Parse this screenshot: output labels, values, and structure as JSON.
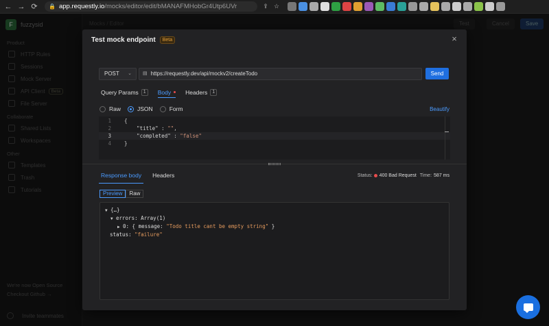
{
  "browser": {
    "url_host": "app.requestly.io",
    "url_path": "/mocks/editor/edit/bMANAFMHobGr4Utp6UVr",
    "extension_colors": [
      "#777",
      "#4a90e2",
      "#aaa",
      "#e0e0e0",
      "#2ea043",
      "#dd4444",
      "#e0a030",
      "#9b59b6",
      "#5dbb63",
      "#3a7bd5",
      "#2aa198",
      "#999",
      "#aaa",
      "#e6c35c",
      "#aaa",
      "#ccc",
      "#aaa",
      "#8bc34a",
      "#ccc",
      "#999"
    ]
  },
  "app": {
    "workspace_initial": "F",
    "workspace_name": "fuzzysid",
    "sections": [
      {
        "title": "Product",
        "items": [
          "HTTP Rules",
          "Sessions",
          "Mock Server",
          "API Client",
          "File Server"
        ]
      },
      {
        "title": "Collaborate",
        "items": [
          "Shared Lists",
          "Workspaces"
        ]
      },
      {
        "title": "Other",
        "items": [
          "Templates",
          "Trash",
          "Tutorials"
        ]
      }
    ],
    "api_client_pill": "Beta",
    "footer_line1": "We're now Open Source",
    "footer_line2": "Checkout Github →",
    "invite": "Invite teammates",
    "crumb": "Mocks / Editor",
    "test_label": "Test",
    "cancel_label": "Cancel",
    "save_label": "Save"
  },
  "modal": {
    "title": "Test mock endpoint",
    "badge": "Beta",
    "close": "×",
    "method": "POST",
    "url": "https://requestly.dev/api/mockv2/createTodo",
    "send": "Send",
    "tabs": [
      {
        "label": "Query Params",
        "count": "1"
      },
      {
        "label": "Body"
      },
      {
        "label": "Headers",
        "count": "1"
      }
    ],
    "body_types": [
      "Raw",
      "JSON",
      "Form"
    ],
    "selected_body_type": "JSON",
    "beautify": "Beautify",
    "editor_lines": [
      {
        "n": "1",
        "text": "{"
      },
      {
        "n": "2",
        "key": "\"title\"",
        "sep": " : ",
        "val": "\"\"",
        "tail": ","
      },
      {
        "n": "3",
        "key": "\"completed\"",
        "sep": " : ",
        "val": "\"false\"",
        "tail": ""
      },
      {
        "n": "4",
        "text": "}"
      }
    ],
    "response_tabs": [
      "Response body",
      "Headers"
    ],
    "status_label": "Status:",
    "status_value": "400 Bad Request",
    "time_label": "Time:",
    "time_value": "587 ms",
    "view_modes": [
      "Preview",
      "Raw"
    ],
    "response": {
      "root": "{…}",
      "errors_key": "errors:",
      "errors_type": "Array(1)",
      "item_index": "0:",
      "item_open": "{ message: ",
      "item_message": "\"Todo title cant be empty string\"",
      "item_close": " }",
      "status_key": "status:",
      "status_val": "\"failure\""
    }
  }
}
